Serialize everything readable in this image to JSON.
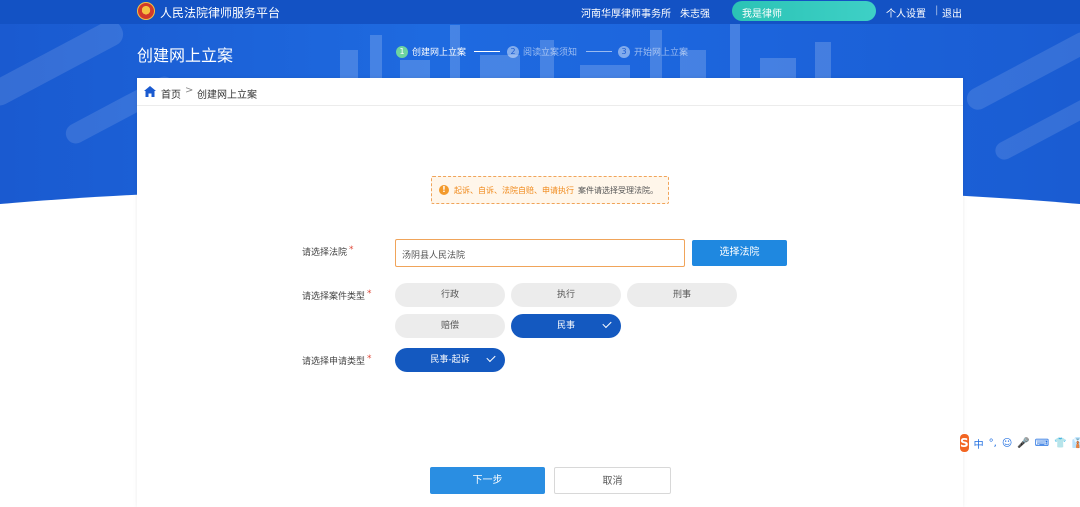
{
  "header": {
    "site_title": "人民法院律师服务平台",
    "firm": "河南华厚律师事务所",
    "user": "朱志强",
    "role_button": "我是律师",
    "settings": "个人设置",
    "separator": "|",
    "logout": "退出"
  },
  "page": {
    "title": "创建网上立案",
    "steps": [
      {
        "num": "1",
        "label": "创建网上立案",
        "state": "active"
      },
      {
        "num": "2",
        "label": "阅读立案须知",
        "state": "inactive"
      },
      {
        "num": "3",
        "label": "开始网上立案",
        "state": "inactive"
      }
    ]
  },
  "breadcrumb": {
    "home": "首页",
    "arrow": ">",
    "current": "创建网上立案"
  },
  "notice": {
    "icon": "!",
    "highlight": "起诉、自诉、法院自赔、申请执行",
    "rest": "案件请选择受理法院。"
  },
  "form": {
    "required_mark": "*",
    "court_label": "请选择法院",
    "court_value": "汤阴县人民法院",
    "choose_court_button": "选择法院",
    "case_type_label": "请选择案件类型",
    "case_types": [
      {
        "label": "行政",
        "selected": false
      },
      {
        "label": "执行",
        "selected": false
      },
      {
        "label": "刑事",
        "selected": false
      },
      {
        "label": "赔偿",
        "selected": false
      },
      {
        "label": "民事",
        "selected": true
      }
    ],
    "apply_type_label": "请选择申请类型",
    "apply_types": [
      {
        "label": "民事-起诉",
        "selected": true
      }
    ]
  },
  "actions": {
    "next": "下一步",
    "cancel": "取消"
  },
  "ime_toolbar": {
    "logo": "S",
    "items": [
      "中",
      "°,",
      "☺",
      "🎤",
      "⌨",
      "👕",
      "👔"
    ]
  },
  "colors": {
    "primary": "#1f88e0",
    "header_bg": "#1a5ad0",
    "selected_pill": "#1459c0",
    "notice_orange": "#f08a1c",
    "active_step": "#6dd4a0"
  }
}
